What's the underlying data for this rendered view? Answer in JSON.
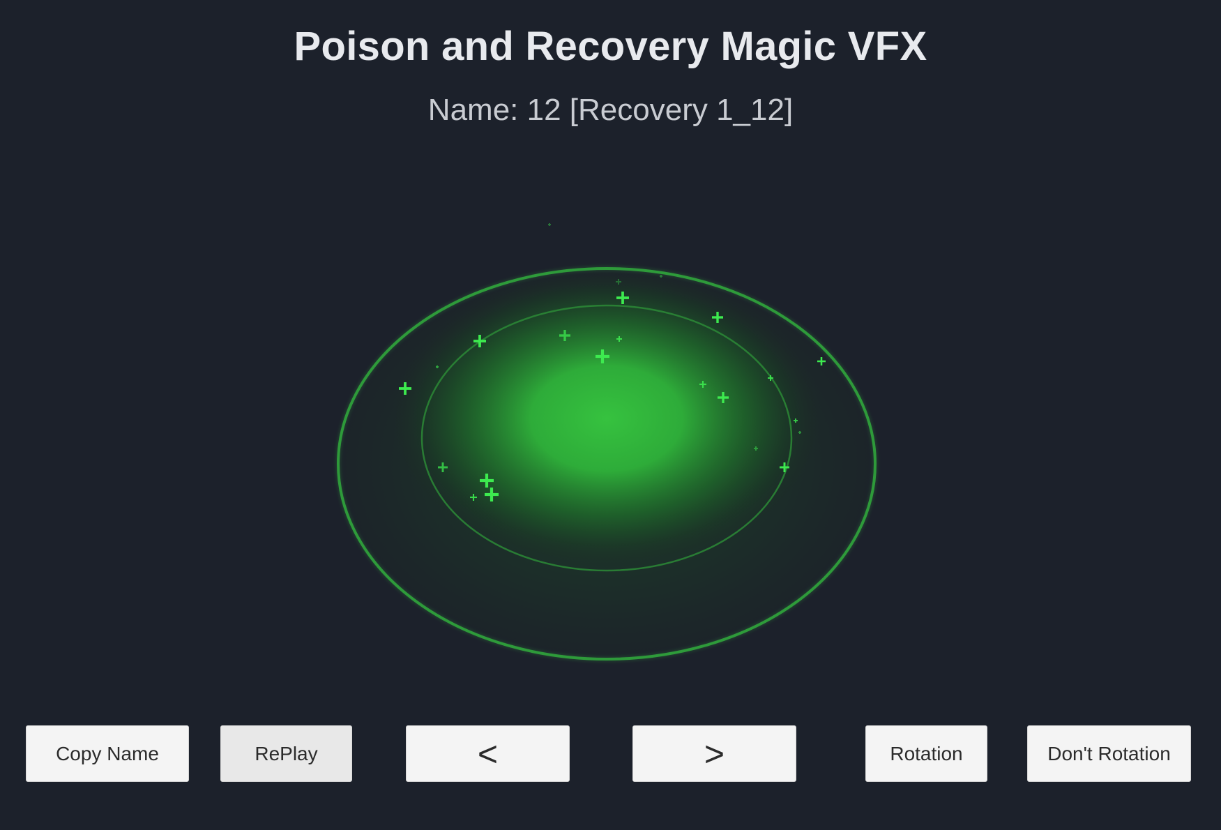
{
  "header": {
    "title": "Poison and Recovery Magic VFX",
    "effect_name": "Name: 12 [Recovery 1_12]"
  },
  "effect": {
    "type": "recovery-circle",
    "color": "#33b53c",
    "ring_color": "#2f9e3a",
    "particle_color": "#3dea4f",
    "particle_icon": "plus-cross"
  },
  "controls": {
    "copy_name": "Copy Name",
    "replay": "RePlay",
    "prev": "<",
    "next": ">",
    "rotation": "Rotation",
    "dont_rotation": "Don't Rotation"
  }
}
